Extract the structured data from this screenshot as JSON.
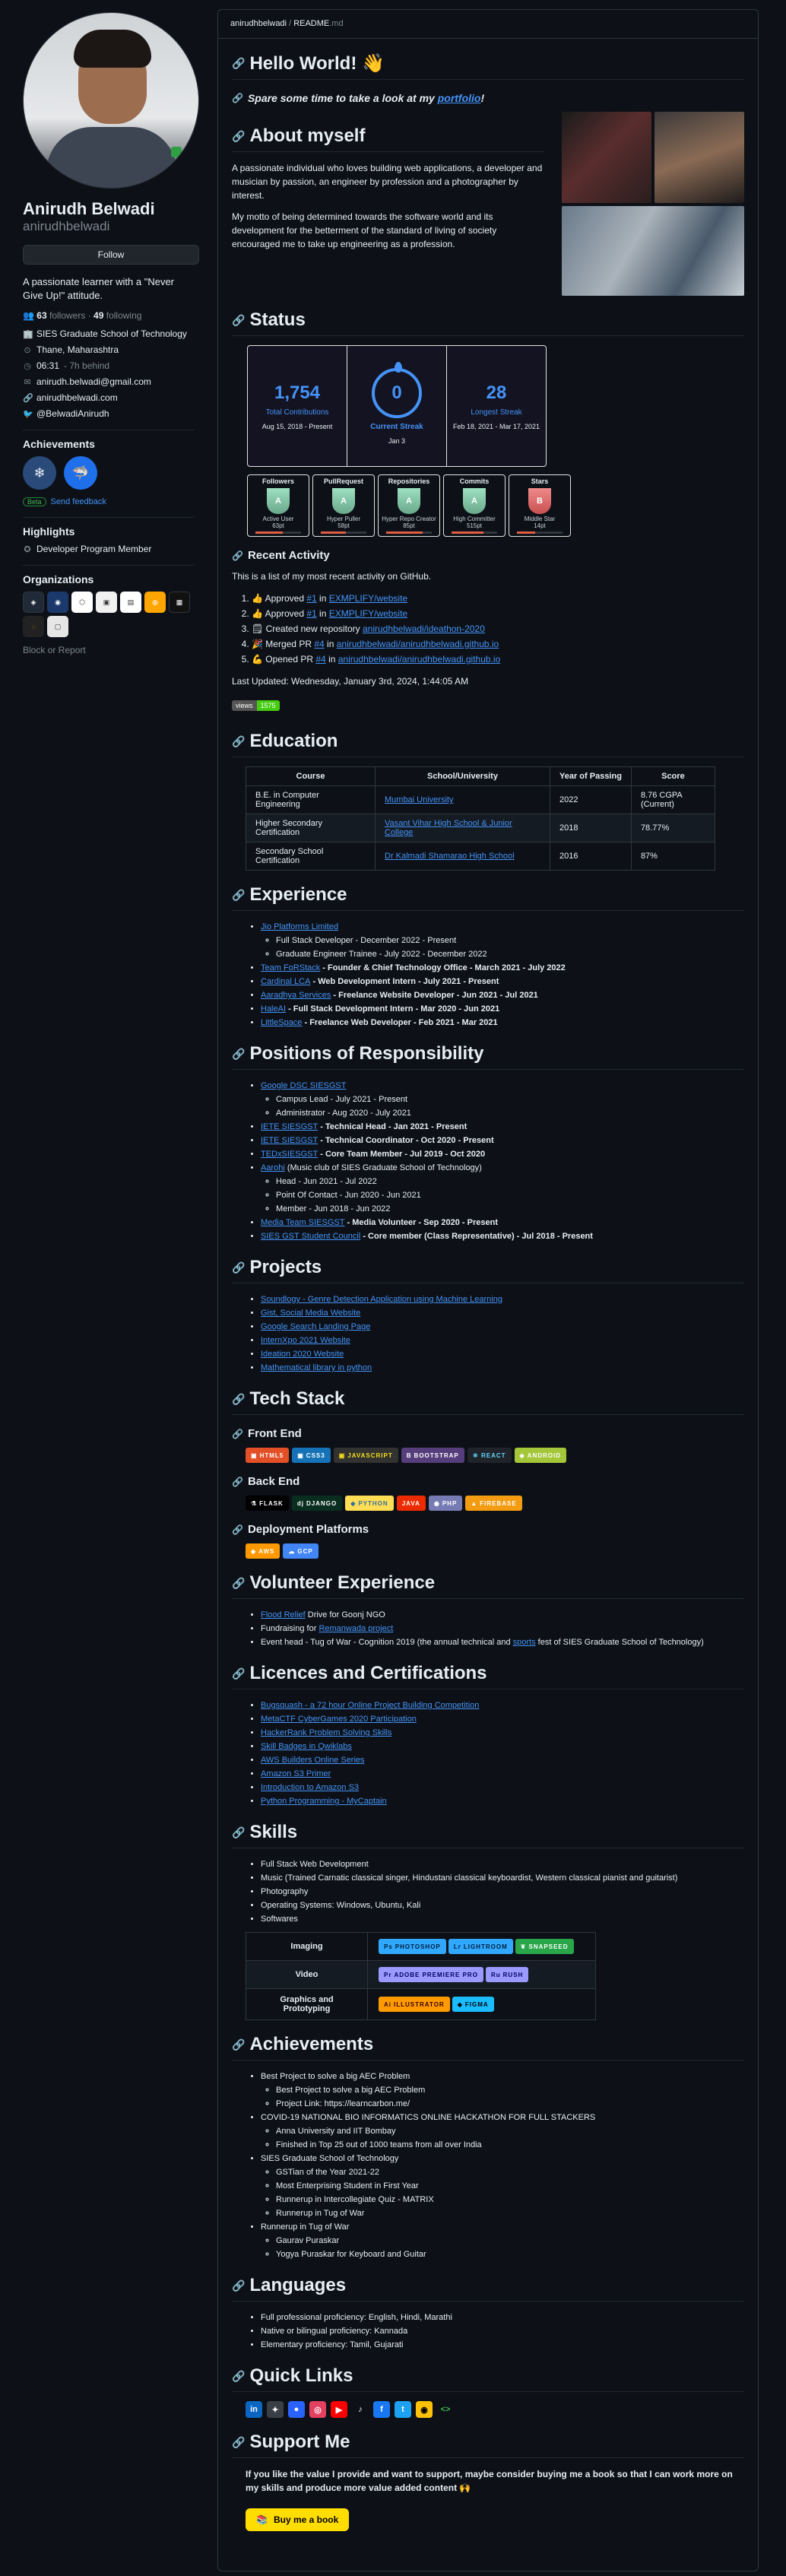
{
  "profile": {
    "name": "Anirudh Belwadi",
    "username": "anirudhbelwadi",
    "follow_label": "Follow",
    "bio": "A passionate learner with a \"Never Give Up!\" attitude.",
    "followers": "63",
    "followers_label": "followers",
    "following": "49",
    "following_label": "following",
    "org": "SIES Graduate School of Technology",
    "location": "Thane, Maharashtra",
    "time": "06:31",
    "time_sub": "- 7h behind",
    "email": "anirudh.belwadi@gmail.com",
    "website": "anirudhbelwadi.com",
    "twitter": "@BelwadiAnirudh"
  },
  "sidebar": {
    "achievements_title": "Achievements",
    "beta_label": "Beta",
    "feedback_label": "Send feedback",
    "highlights_title": "Highlights",
    "highlight_item": "Developer Program Member",
    "orgs_title": "Organizations",
    "block_label": "Block or Report"
  },
  "file": {
    "path_user": "anirudhbelwadi",
    "path_sep": "/",
    "path_file": "README",
    "path_ext": ".md"
  },
  "hello": {
    "title": "Hello World! 👋",
    "spare": "Spare some time to take a look at my",
    "portfolio": "portfolio",
    "bang": "!"
  },
  "about": {
    "title": "About myself",
    "p1": "A passionate individual who loves building web applications, a developer and musician by passion, an engineer by profession and a photographer by interest.",
    "p2": "My motto of being determined towards the software world and its development for the betterment of the standard of living of society encouraged me to take up engineering as a profession."
  },
  "status": {
    "title": "Status",
    "total": "1,754",
    "total_label": "Total Contributions",
    "total_range": "Aug 15, 2018 - Present",
    "current": "0",
    "current_label": "Current Streak",
    "current_range": "Jan 3",
    "longest": "28",
    "longest_label": "Longest Streak",
    "longest_range": "Feb 18, 2021 - Mar 17, 2021",
    "trophies": [
      {
        "title": "Followers",
        "rank": "A",
        "name": "Active User",
        "val": "63pt"
      },
      {
        "title": "PullRequest",
        "rank": "A",
        "name": "Hyper Puller",
        "val": "58pt"
      },
      {
        "title": "Repositories",
        "rank": "A",
        "name": "Hyper Repo Creator",
        "val": "85pt"
      },
      {
        "title": "Commits",
        "rank": "A",
        "name": "High Committer",
        "val": "515pt"
      },
      {
        "title": "Stars",
        "rank": "B",
        "name": "Middle Star",
        "val": "14pt"
      }
    ]
  },
  "recent": {
    "title": "Recent Activity",
    "intro": "This is a list of my most recent activity on GitHub.",
    "items": [
      {
        "icon": "👍",
        "pre": "Approved",
        "num": "#1",
        "in": "in",
        "repo": "EXMPLIFY/website"
      },
      {
        "icon": "👍",
        "pre": "Approved",
        "num": "#1",
        "in": "in",
        "repo": "EXMPLIFY/website"
      },
      {
        "icon": "🗒",
        "pre": "Created new repository",
        "num": "",
        "in": "",
        "repo": "anirudhbelwadi/ideathon-2020"
      },
      {
        "icon": "🎉",
        "pre": "Merged PR",
        "num": "#4",
        "in": "in",
        "repo": "anirudhbelwadi/anirudhbelwadi.github.io"
      },
      {
        "icon": "💪",
        "pre": "Opened PR",
        "num": "#4",
        "in": "in",
        "repo": "anirudhbelwadi/anirudhbelwadi.github.io"
      }
    ],
    "updated": "Last Updated: Wednesday, January 3rd, 2024, 1:44:05 AM",
    "views_label": "views",
    "views_count": "1575"
  },
  "education": {
    "title": "Education",
    "headers": [
      "Course",
      "School/University",
      "Year of Passing",
      "Score"
    ],
    "rows": [
      [
        "B.E. in Computer Engineering",
        "Mumbai University",
        "2022",
        "8.76 CGPA (Current)"
      ],
      [
        "Higher Secondary Certification",
        "Vasant Vihar High School & Junior College",
        "2018",
        "78.77%"
      ],
      [
        "Secondary School Certification",
        "Dr Kalmadi Shamarao High School",
        "2016",
        "87%"
      ]
    ]
  },
  "experience": {
    "title": "Experience",
    "items": [
      {
        "org": "Jio Platforms Limited",
        "role": "",
        "sub": [
          "Full Stack Developer - December 2022 - Present",
          "Graduate Engineer Trainee - July 2022 - December 2022"
        ]
      },
      {
        "org": "Team FoRStack",
        "role": " - Founder & Chief Technology Office - March 2021 - July 2022",
        "sub": []
      },
      {
        "org": "Cardinal LCA",
        "role": " - Web Development Intern - July 2021 - Present",
        "sub": []
      },
      {
        "org": "Aaradhya Services",
        "role": " - Freelance Website Developer - Jun 2021 - Jul 2021",
        "sub": []
      },
      {
        "org": "HaleAI",
        "role": " - Full Stack Development Intern - Mar 2020 - Jun 2021",
        "sub": []
      },
      {
        "org": "LittleSpace",
        "role": " - Freelance Web Developer - Feb 2021 - Mar 2021",
        "sub": []
      }
    ]
  },
  "por": {
    "title": "Positions of Responsibility",
    "items": [
      {
        "org": "Google DSC SIESGST",
        "role": "",
        "sub": [
          "Campus Lead - July 2021 - Present",
          "Administrator - Aug 2020 - July 2021"
        ]
      },
      {
        "org": "IETE SIESGST",
        "role": " - Technical Head - Jan 2021 - Present",
        "sub": []
      },
      {
        "org": "IETE SIESGST",
        "role": " - Technical Coordinator - Oct 2020 - Present",
        "sub": []
      },
      {
        "org": "TEDxSIESGST",
        "role": " - Core Team Member - Jul 2019 - Oct 2020",
        "sub": []
      },
      {
        "org": "Aarohi",
        "role": " (Music club of SIES Graduate School of Technology)",
        "sub": [
          "Head - Jun 2021 - Jul 2022",
          "Point Of Contact - Jun 2020 - Jun 2021",
          "Member - Jun 2018 - Jun 2022"
        ]
      },
      {
        "org": "Media Team SIESGST",
        "role": " - Media Volunteer - Sep 2020 - Present",
        "sub": []
      },
      {
        "org": "SIES GST Student Council",
        "role": " - Core member (Class Representative) - Jul 2018 - Present",
        "sub": []
      }
    ]
  },
  "projects": {
    "title": "Projects",
    "items": [
      "Soundlogy - Genre Detection Application using Machine Learning",
      "Gist, Social Media Website",
      "Google Search Landing Page",
      "InternXpo 2021 Website",
      "Ideation 2020 Website",
      "Mathematical library in python"
    ]
  },
  "tech": {
    "title": "Tech Stack",
    "front_title": "Front End",
    "front": [
      {
        "label": "HTML5",
        "color": "#e34f26"
      },
      {
        "label": "CSS3",
        "color": "#1572b6"
      },
      {
        "label": "JAVASCRIPT",
        "color": "#323330"
      },
      {
        "label": "BOOTSTRAP",
        "color": "#563d7c"
      },
      {
        "label": "REACT",
        "color": "#20232a"
      },
      {
        "label": "ANDROID",
        "color": "#a4c639"
      }
    ],
    "back_title": "Back End",
    "back": [
      {
        "label": "FLASK",
        "color": "#000000"
      },
      {
        "label": "DJANGO",
        "color": "#092e20"
      },
      {
        "label": "PYTHON",
        "color": "#ffdd54"
      },
      {
        "label": "JAVA",
        "color": "#ed2b00"
      },
      {
        "label": "PHP",
        "color": "#777bb4"
      },
      {
        "label": "FIREBASE",
        "color": "#f39c12"
      }
    ],
    "deploy_title": "Deployment Platforms",
    "deploy": [
      {
        "label": "AWS",
        "color": "#ff9900"
      },
      {
        "label": "GCP",
        "color": "#4285f4"
      }
    ]
  },
  "volunteer": {
    "title": "Volunteer Experience",
    "items": [
      {
        "link": "Flood Relief",
        "text": " Drive for Goonj NGO"
      },
      {
        "pre": "Fundraising for ",
        "link": "Remanwada project",
        "text": ""
      },
      {
        "pre": "Event head - Tug of War - Cognition 2019 (the annual technical and ",
        "link": "sports",
        "text": " fest of SIES Graduate School of Technology)"
      }
    ]
  },
  "licences": {
    "title": "Licences and Certifications",
    "items": [
      "Bugsquash - a 72 hour Online Project Building Competition",
      "MetaCTF CyberGames 2020 Participation",
      "HackerRank Problem Solving Skills",
      "Skill Badges in Qwiklabs",
      "AWS Builders Online Series",
      "Amazon S3 Primer",
      "Introduction to Amazon S3",
      "Python Programming - MyCaptain"
    ]
  },
  "skills": {
    "title": "Skills",
    "items": [
      "Full Stack Web Development",
      "Music (Trained Carnatic classical singer, Hindustani classical keyboardist, Western classical pianist and guitarist)",
      "Photography",
      "Operating Systems: Windows, Ubuntu, Kali",
      "Softwares"
    ],
    "table": [
      {
        "label": "Imaging",
        "badges": [
          {
            "label": "PHOTOSHOP",
            "color": "#31a8ff"
          },
          {
            "label": "LIGHTROOM",
            "color": "#31a8ff"
          },
          {
            "label": "SNAPSEED",
            "color": "#29a64a"
          }
        ]
      },
      {
        "label": "Video",
        "badges": [
          {
            "label": "ADOBE PREMIERE PRO",
            "color": "#9999ff"
          },
          {
            "label": "RUSH",
            "color": "#9999ff"
          }
        ]
      },
      {
        "label": "Graphics and Prototyping",
        "badges": [
          {
            "label": "ILLUSTRATOR",
            "color": "#ff9a00"
          },
          {
            "label": "FIGMA",
            "color": "#1abcfe"
          }
        ]
      }
    ]
  },
  "achievements": {
    "title": "Achievements",
    "items": [
      {
        "text": "Best Project to solve a big AEC Problem",
        "sub": [
          "Best Project to solve a big AEC Problem",
          "Project Link: https://learncarbon.me/"
        ]
      },
      {
        "text": "COVID-19 NATIONAL BIO INFORMATICS ONLINE HACKATHON FOR FULL STACKERS",
        "sub": [
          "Anna University and IIT Bombay",
          "Finished in Top 25 out of 1000 teams from all over India"
        ]
      },
      {
        "text": "SIES Graduate School of Technology",
        "sub": [
          "GSTian of the Year 2021-22",
          "Most Enterprising Student in First Year",
          "Runnerup in Intercollegiate Quiz - MATRIX",
          "Runnerup in Tug of War"
        ]
      },
      {
        "text": "Runnerup in Tug of War",
        "sub": [
          "Gaurav Puraskar",
          "Yogya Puraskar for Keyboard and Guitar"
        ]
      }
    ]
  },
  "languages": {
    "title": "Languages",
    "items": [
      "Full professional proficiency: English, Hindi, Marathi",
      "Native or bilingual proficiency: Kannada",
      "Elementary proficiency: Tamil, Gujarati"
    ]
  },
  "quick": {
    "title": "Quick Links",
    "icons": [
      {
        "name": "linkedin-icon",
        "glyph": "in",
        "color": "#0a66c2"
      },
      {
        "name": "badge-icon",
        "glyph": "✦",
        "color": "#7d8590"
      },
      {
        "name": "hashnode-icon",
        "glyph": "●",
        "color": "#2962ff"
      },
      {
        "name": "instagram-icon",
        "glyph": "◎",
        "color": "#e4405f"
      },
      {
        "name": "youtube-icon",
        "glyph": "▶",
        "color": "#ff0000"
      },
      {
        "name": "music-icon",
        "glyph": "♪",
        "color": "#e6edf3"
      },
      {
        "name": "facebook-icon",
        "glyph": "f",
        "color": "#1877f2"
      },
      {
        "name": "twitter-icon",
        "glyph": "t",
        "color": "#1da1f2"
      },
      {
        "name": "medium-icon",
        "glyph": "◉",
        "color": "#ffc107"
      },
      {
        "name": "code-icon",
        "glyph": "<>",
        "color": "#7d8590"
      }
    ]
  },
  "support": {
    "title": "Support Me",
    "text": "If you like the value I provide and want to support, maybe consider buying me a book so that I can work more on my skills and produce more value added content 🙌",
    "button": "Buy me a book"
  }
}
